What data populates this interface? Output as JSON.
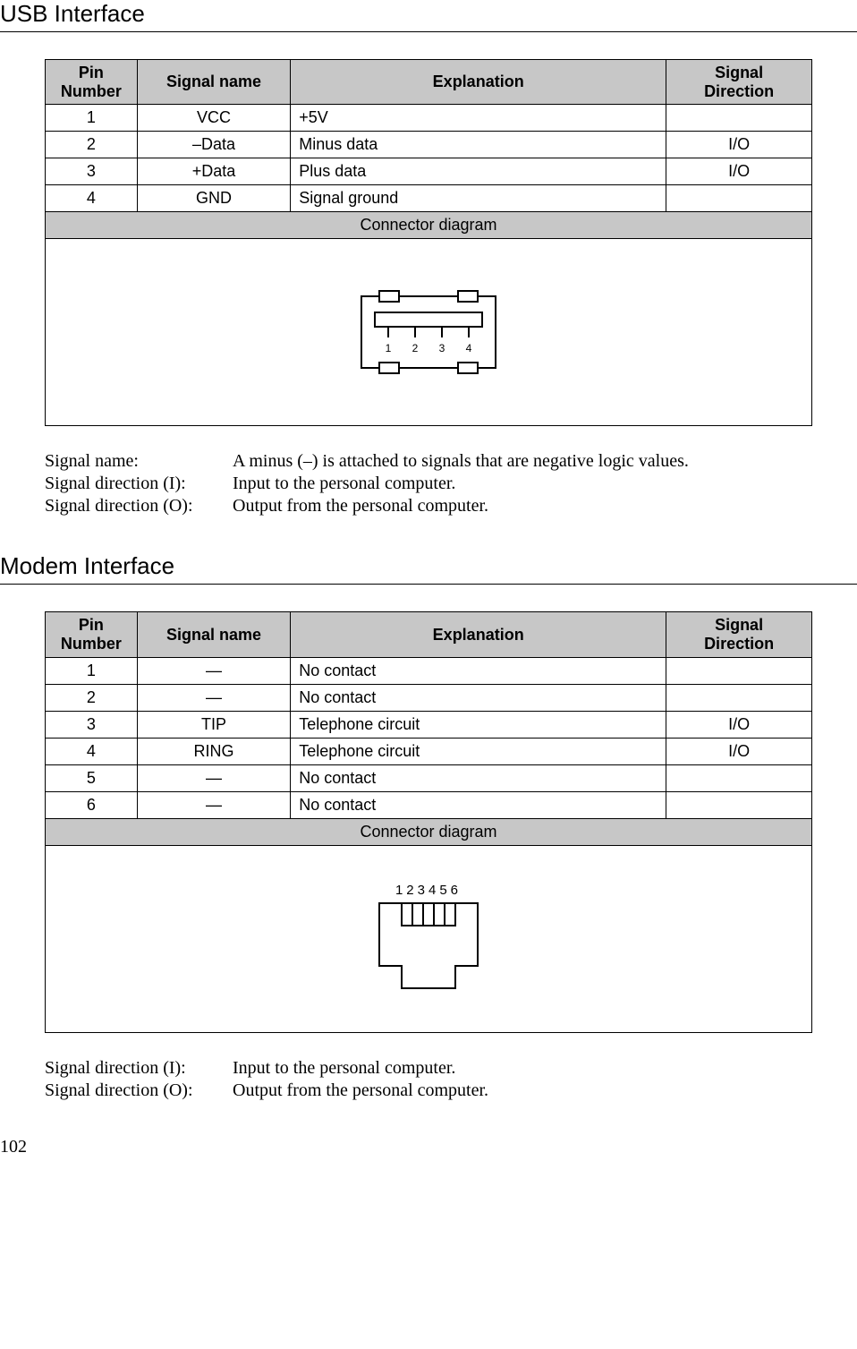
{
  "sections": {
    "usb": {
      "title": "USB Interface",
      "headers": {
        "pin": "Pin\nNumber",
        "signal": "Signal name",
        "explanation": "Explanation",
        "direction": "Signal\nDirection"
      },
      "rows": [
        {
          "pin": "1",
          "signal": "VCC",
          "explanation": "+5V",
          "direction": ""
        },
        {
          "pin": "2",
          "signal": "–Data",
          "explanation": "Minus data",
          "direction": "I/O"
        },
        {
          "pin": "3",
          "signal": "+Data",
          "explanation": "Plus data",
          "direction": "I/O"
        },
        {
          "pin": "4",
          "signal": "GND",
          "explanation": "Signal ground",
          "direction": ""
        }
      ],
      "connector_label": "Connector diagram",
      "diagram_pins": [
        "1",
        "2",
        "3",
        "4"
      ],
      "notes": [
        {
          "label": "Signal name:",
          "text": "A minus (–) is attached to signals that are negative logic values."
        },
        {
          "label": "Signal direction (I):",
          "text": "Input to the personal computer."
        },
        {
          "label": "Signal direction (O):",
          "text": "Output from the personal computer."
        }
      ]
    },
    "modem": {
      "title": "Modem Interface",
      "headers": {
        "pin": "Pin\nNumber",
        "signal": "Signal name",
        "explanation": "Explanation",
        "direction": "Signal\nDirection"
      },
      "rows": [
        {
          "pin": "1",
          "signal": "—",
          "explanation": "No contact",
          "direction": ""
        },
        {
          "pin": "2",
          "signal": "—",
          "explanation": "No contact",
          "direction": ""
        },
        {
          "pin": "3",
          "signal": "TIP",
          "explanation": "Telephone circuit",
          "direction": "I/O"
        },
        {
          "pin": "4",
          "signal": "RING",
          "explanation": "Telephone circuit",
          "direction": "I/O"
        },
        {
          "pin": "5",
          "signal": "—",
          "explanation": "No contact",
          "direction": ""
        },
        {
          "pin": "6",
          "signal": "—",
          "explanation": "No contact",
          "direction": ""
        }
      ],
      "connector_label": "Connector diagram",
      "diagram_pins": "123456",
      "notes": [
        {
          "label": "Signal direction (I):",
          "text": "Input to the personal computer."
        },
        {
          "label": "Signal direction (O):",
          "text": "Output from the personal computer."
        }
      ]
    }
  },
  "page_number": "102"
}
